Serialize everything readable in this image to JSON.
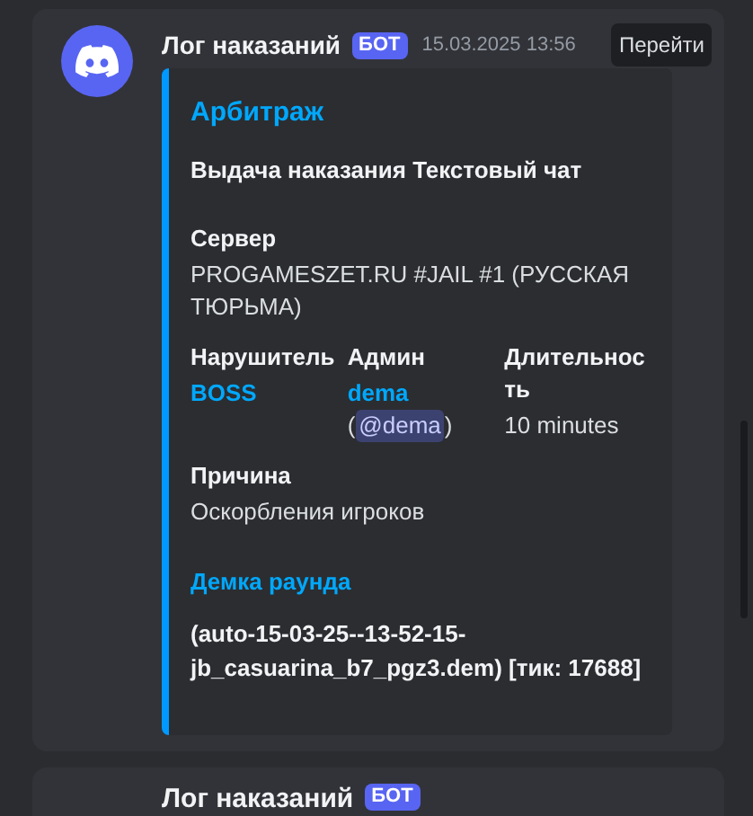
{
  "messages": [
    {
      "author": "Лог наказаний",
      "badge": "БОТ",
      "timestamp": "15.03.2025 13:56",
      "action": "Перейти",
      "embed": {
        "title": "Арбитраж",
        "description": "Выдача наказания Текстовый чат",
        "fields": [
          {
            "name": "Сервер",
            "inline": false,
            "parts": [
              {
                "kind": "text",
                "text": "PROGAMESZET.RU #JAIL #1 (РУССКАЯ ТЮРЬМА)"
              }
            ]
          },
          {
            "name": "Нарушитель",
            "inline": true,
            "parts": [
              {
                "kind": "link",
                "text": "BOSS"
              }
            ]
          },
          {
            "name": "Админ",
            "inline": true,
            "parts": [
              {
                "kind": "link",
                "text": "dema"
              },
              {
                "kind": "text",
                "text": "("
              },
              {
                "kind": "mention",
                "text": "@dema"
              },
              {
                "kind": "text",
                "text": ")"
              }
            ]
          },
          {
            "name": "Длительность",
            "inline": true,
            "parts": [
              {
                "kind": "text",
                "text": "10 minutes"
              }
            ]
          },
          {
            "name": "Причина",
            "inline": false,
            "parts": [
              {
                "kind": "text",
                "text": "Оскорбления игроков"
              }
            ]
          }
        ],
        "section": {
          "title": "Демка раунда",
          "text": "(auto-15-03-25--13-52-15-jb_casuarina_b7_pgz3.dem) [тик: 17688]"
        }
      }
    },
    {
      "author": "Лог наказаний",
      "badge": "БОТ"
    }
  ]
}
